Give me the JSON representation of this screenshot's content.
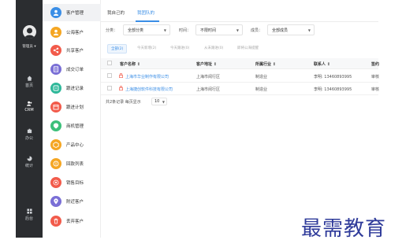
{
  "rail": {
    "user_label": "管理员 ▾",
    "items": [
      {
        "label": "首页",
        "icon": "home-icon"
      },
      {
        "label": "CRM",
        "icon": "people-icon"
      },
      {
        "label": "办公",
        "icon": "office-icon"
      },
      {
        "label": "统计",
        "icon": "stats-icon"
      },
      {
        "label": "后台",
        "icon": "grid-icon"
      }
    ]
  },
  "menu": {
    "items": [
      {
        "label": "客户管理",
        "color": "#3a8ee6",
        "icon": "person-icon"
      },
      {
        "label": "公海客户",
        "color": "#f5a623",
        "icon": "pool-icon"
      },
      {
        "label": "共享客户",
        "color": "#f25b4b",
        "icon": "share-icon"
      },
      {
        "label": "成交订单",
        "color": "#7a6fd6",
        "icon": "order-icon"
      },
      {
        "label": "跟进记录",
        "color": "#2fb89a",
        "icon": "record-icon"
      },
      {
        "label": "跟进计划",
        "color": "#f25b4b",
        "icon": "plan-icon"
      },
      {
        "label": "商机管理",
        "color": "#3cc07a",
        "icon": "opportunity-icon"
      },
      {
        "label": "产品中心",
        "color": "#f5a623",
        "icon": "product-icon"
      },
      {
        "label": "回款列表",
        "color": "#f5a623",
        "icon": "payment-icon"
      },
      {
        "label": "销售目标",
        "color": "#f25b4b",
        "icon": "target-icon"
      },
      {
        "label": "附近客户",
        "color": "#7a6fd6",
        "icon": "location-icon"
      },
      {
        "label": "丢弃客户",
        "color": "#f25b4b",
        "icon": "discard-icon"
      }
    ]
  },
  "tabs": [
    {
      "label": "我自己的"
    },
    {
      "label": "我团队的"
    }
  ],
  "filters": {
    "category_label": "分类：",
    "category_value": "全部分类",
    "time_label": "时间：",
    "time_value": "不限时间",
    "member_label": "成员：",
    "member_value": "全部成员"
  },
  "quick_filters": [
    "全部(2)",
    "今天新增(2)",
    "今天跟进(0)",
    "从未跟进(0)",
    "即将公海提醒"
  ],
  "table": {
    "headers": [
      "客户名称 ↕",
      "客户地址 ↕",
      "所属行业 ↕",
      "联系人 ↕",
      "签约"
    ],
    "rows": [
      {
        "name": "上海市华业制作有限公司",
        "address": "上海市闵行区",
        "industry": "制造业",
        "contact": "李明: 13460893995",
        "extra": "审核"
      },
      {
        "name": "上海捷创软件科技有限公司",
        "address": "上海市闵行区",
        "industry": "制造业",
        "contact": "李明: 13460893995",
        "extra": "审核"
      }
    ]
  },
  "pager": {
    "summary": "共2条记录  每页显示",
    "page_size": "10"
  },
  "watermark": "最需教育"
}
